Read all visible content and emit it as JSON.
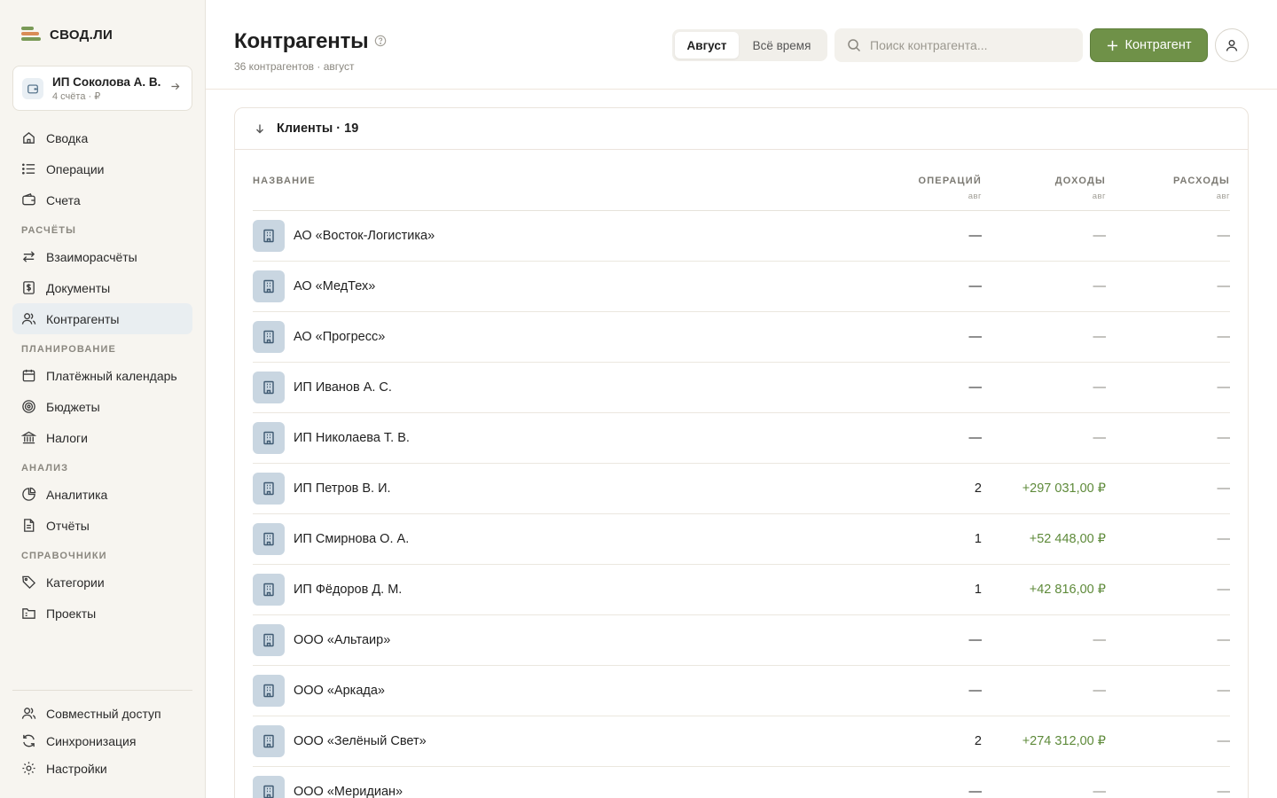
{
  "brand": {
    "name": "СВОД.ЛИ"
  },
  "account": {
    "name": "ИП Соколова А. В.",
    "sub": "4 счёта · ₽"
  },
  "nav": {
    "main": [
      {
        "key": "home",
        "label": "Сводка",
        "icon": "home-icon"
      },
      {
        "key": "operations",
        "label": "Операции",
        "icon": "list-icon"
      },
      {
        "key": "accounts",
        "label": "Счета",
        "icon": "wallet-icon"
      }
    ],
    "sections": [
      {
        "title": "РАСЧЁТЫ",
        "items": [
          {
            "key": "settlements",
            "label": "Взаиморасчёты",
            "icon": "swap-icon"
          },
          {
            "key": "documents",
            "label": "Документы",
            "icon": "document-dollar-icon"
          },
          {
            "key": "counterparties",
            "label": "Контрагенты",
            "icon": "users-icon",
            "active": true
          }
        ]
      },
      {
        "title": "ПЛАНИРОВАНИЕ",
        "items": [
          {
            "key": "calendar",
            "label": "Платёжный календарь",
            "icon": "calendar-icon"
          },
          {
            "key": "budgets",
            "label": "Бюджеты",
            "icon": "target-icon"
          },
          {
            "key": "taxes",
            "label": "Налоги",
            "icon": "bank-icon"
          }
        ]
      },
      {
        "title": "АНАЛИЗ",
        "items": [
          {
            "key": "analytics",
            "label": "Аналитика",
            "icon": "pie-chart-icon"
          },
          {
            "key": "reports",
            "label": "Отчёты",
            "icon": "report-icon"
          }
        ]
      },
      {
        "title": "СПРАВОЧНИКИ",
        "items": [
          {
            "key": "categories",
            "label": "Категории",
            "icon": "tag-icon"
          },
          {
            "key": "projects",
            "label": "Проекты",
            "icon": "folder-icon"
          }
        ]
      }
    ],
    "bottom": [
      {
        "key": "sharing",
        "label": "Совместный доступ",
        "icon": "users-icon"
      },
      {
        "key": "sync",
        "label": "Синхронизация",
        "icon": "sync-icon"
      },
      {
        "key": "settings",
        "label": "Настройки",
        "icon": "gear-icon"
      }
    ]
  },
  "header": {
    "title": "Контрагенты",
    "subtitle": "36 контрагентов · август",
    "period": {
      "active": "Август",
      "other": "Всё время"
    },
    "search_placeholder": "Поиск контрагента...",
    "add_label": "Контрагент"
  },
  "group": {
    "title": "Клиенты · 19"
  },
  "table": {
    "headers": {
      "name": "НАЗВАНИЕ",
      "ops": "ОПЕРАЦИЙ",
      "ops_sub": "авг",
      "income": "ДОХОДЫ",
      "income_sub": "авг",
      "expense": "РАСХОДЫ",
      "expense_sub": "авг"
    },
    "rows": [
      {
        "name": "АО «Восток-Логистика»",
        "ops": "—",
        "income": "—",
        "expense": "—"
      },
      {
        "name": "АО «МедТех»",
        "ops": "—",
        "income": "—",
        "expense": "—"
      },
      {
        "name": "АО «Прогресс»",
        "ops": "—",
        "income": "—",
        "expense": "—"
      },
      {
        "name": "ИП Иванов А. С.",
        "ops": "—",
        "income": "—",
        "expense": "—"
      },
      {
        "name": "ИП Николаева Т. В.",
        "ops": "—",
        "income": "—",
        "expense": "—"
      },
      {
        "name": "ИП Петров В. И.",
        "ops": "2",
        "income": "+297 031,00 ₽",
        "expense": "—"
      },
      {
        "name": "ИП Смирнова О. А.",
        "ops": "1",
        "income": "+52 448,00 ₽",
        "expense": "—"
      },
      {
        "name": "ИП Фёдоров Д. М.",
        "ops": "1",
        "income": "+42 816,00 ₽",
        "expense": "—"
      },
      {
        "name": "ООО «Альтаир»",
        "ops": "—",
        "income": "—",
        "expense": "—"
      },
      {
        "name": "ООО «Аркада»",
        "ops": "—",
        "income": "—",
        "expense": "—"
      },
      {
        "name": "ООО «Зелёный Свет»",
        "ops": "2",
        "income": "+274 312,00 ₽",
        "expense": "—"
      },
      {
        "name": "ООО «Меридиан»",
        "ops": "—",
        "income": "—",
        "expense": "—"
      }
    ]
  },
  "colors": {
    "accent": "#6f9148",
    "positive": "#5e8a3a",
    "active_nav": "#e9eef1"
  }
}
